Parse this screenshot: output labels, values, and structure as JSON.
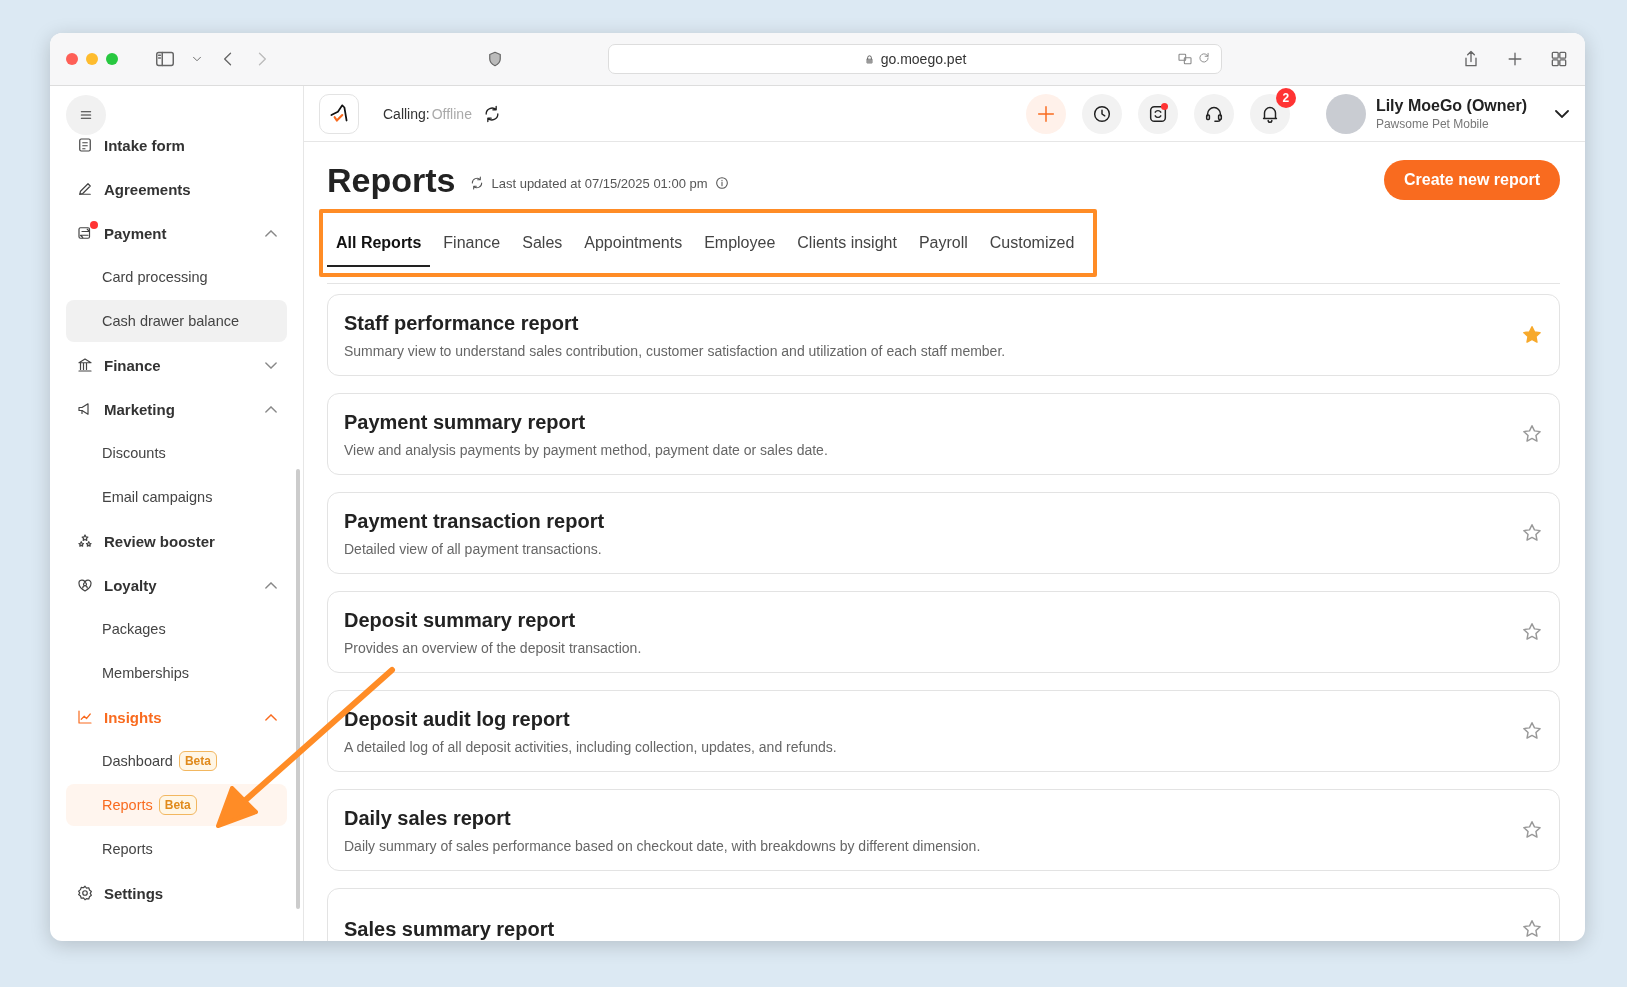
{
  "browser": {
    "url": "go.moego.pet"
  },
  "sidebar": {
    "items": [
      {
        "label": "Intake form",
        "selected": false,
        "notification_dot": false
      },
      {
        "label": "Agreements",
        "selected": false,
        "notification_dot": false
      },
      {
        "label": "Payment",
        "selected": false,
        "expanded": true,
        "notification_dot": true,
        "children": [
          {
            "label": "Card processing",
            "selected": false,
            "hovered": false
          },
          {
            "label": "Cash drawer balance",
            "selected": false,
            "hovered": true
          }
        ]
      },
      {
        "label": "Finance",
        "selected": false,
        "expanded": false,
        "notification_dot": false
      },
      {
        "label": "Marketing",
        "selected": false,
        "expanded": true,
        "notification_dot": false,
        "children": [
          {
            "label": "Discounts",
            "selected": false,
            "hovered": false
          },
          {
            "label": "Email campaigns",
            "selected": false,
            "hovered": false
          }
        ]
      },
      {
        "label": "Review booster",
        "selected": false,
        "notification_dot": false
      },
      {
        "label": "Loyalty",
        "selected": false,
        "expanded": true,
        "notification_dot": false,
        "children": [
          {
            "label": "Packages",
            "selected": false,
            "hovered": false
          },
          {
            "label": "Memberships",
            "selected": false,
            "hovered": false
          }
        ]
      },
      {
        "label": "Insights",
        "selected": true,
        "expanded": true,
        "notification_dot": false,
        "children": [
          {
            "label": "Dashboard",
            "badge": "Beta",
            "selected": false,
            "hovered": false
          },
          {
            "label": "Reports",
            "badge": "Beta",
            "selected": true,
            "hovered": false
          },
          {
            "label": "Reports",
            "selected": false,
            "hovered": false
          }
        ]
      },
      {
        "label": "Settings",
        "selected": false,
        "notification_dot": false
      }
    ]
  },
  "header": {
    "calling_label": "Calling:",
    "calling_status": "Offline",
    "notification_count": "2",
    "sync_dot": true,
    "user": {
      "name": "Lily MoeGo (Owner)",
      "business": "Pawsome Pet Mobile"
    }
  },
  "page": {
    "title": "Reports",
    "last_updated": "Last updated at 07/15/2025 01:00 pm",
    "create_button": "Create new report"
  },
  "tabs": [
    {
      "label": "All Reports",
      "selected": true
    },
    {
      "label": "Finance",
      "selected": false
    },
    {
      "label": "Sales",
      "selected": false
    },
    {
      "label": "Appointments",
      "selected": false
    },
    {
      "label": "Employee",
      "selected": false
    },
    {
      "label": "Clients insight",
      "selected": false
    },
    {
      "label": "Payroll",
      "selected": false
    },
    {
      "label": "Customized",
      "selected": false
    }
  ],
  "reports": [
    {
      "title": "Staff performance report",
      "description": "Summary view to understand sales contribution, customer satisfaction and utilization of each staff member.",
      "starred": true
    },
    {
      "title": "Payment summary report",
      "description": "View and analysis payments by payment method, payment date or sales date.",
      "starred": false
    },
    {
      "title": "Payment transaction report",
      "description": "Detailed view of all payment transactions.",
      "starred": false
    },
    {
      "title": "Deposit summary report",
      "description": "Provides an overview of the deposit transaction.",
      "starred": false
    },
    {
      "title": "Deposit audit log report",
      "description": "A detailed log of all deposit activities, including collection, updates, and refunds.",
      "starred": false
    },
    {
      "title": "Daily sales report",
      "description": "Daily summary of sales performance based on checkout date, with breakdowns by different dimension.",
      "starred": false
    },
    {
      "title": "Sales summary report",
      "starred": false
    }
  ]
}
